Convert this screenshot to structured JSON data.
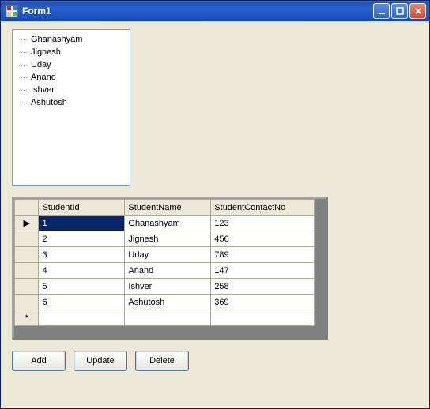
{
  "window": {
    "title": "Form1"
  },
  "tree": {
    "items": [
      {
        "label": "Ghanashyam"
      },
      {
        "label": "Jignesh"
      },
      {
        "label": "Uday"
      },
      {
        "label": "Anand"
      },
      {
        "label": "Ishver"
      },
      {
        "label": "Ashutosh"
      }
    ]
  },
  "grid": {
    "columns": [
      "StudentId",
      "StudentName",
      "StudentContactNo"
    ],
    "rowmarker_current": "▶",
    "rowmarker_new": "*",
    "rows": [
      {
        "id": "1",
        "name": "Ghanashyam",
        "contact": "123"
      },
      {
        "id": "2",
        "name": "Jignesh",
        "contact": "456"
      },
      {
        "id": "3",
        "name": "Uday",
        "contact": "789"
      },
      {
        "id": "4",
        "name": "Anand",
        "contact": "147"
      },
      {
        "id": "5",
        "name": "Ishver",
        "contact": "258"
      },
      {
        "id": "6",
        "name": "Ashutosh",
        "contact": "369"
      }
    ]
  },
  "buttons": {
    "add": "Add",
    "update": "Update",
    "delete": "Delete"
  }
}
